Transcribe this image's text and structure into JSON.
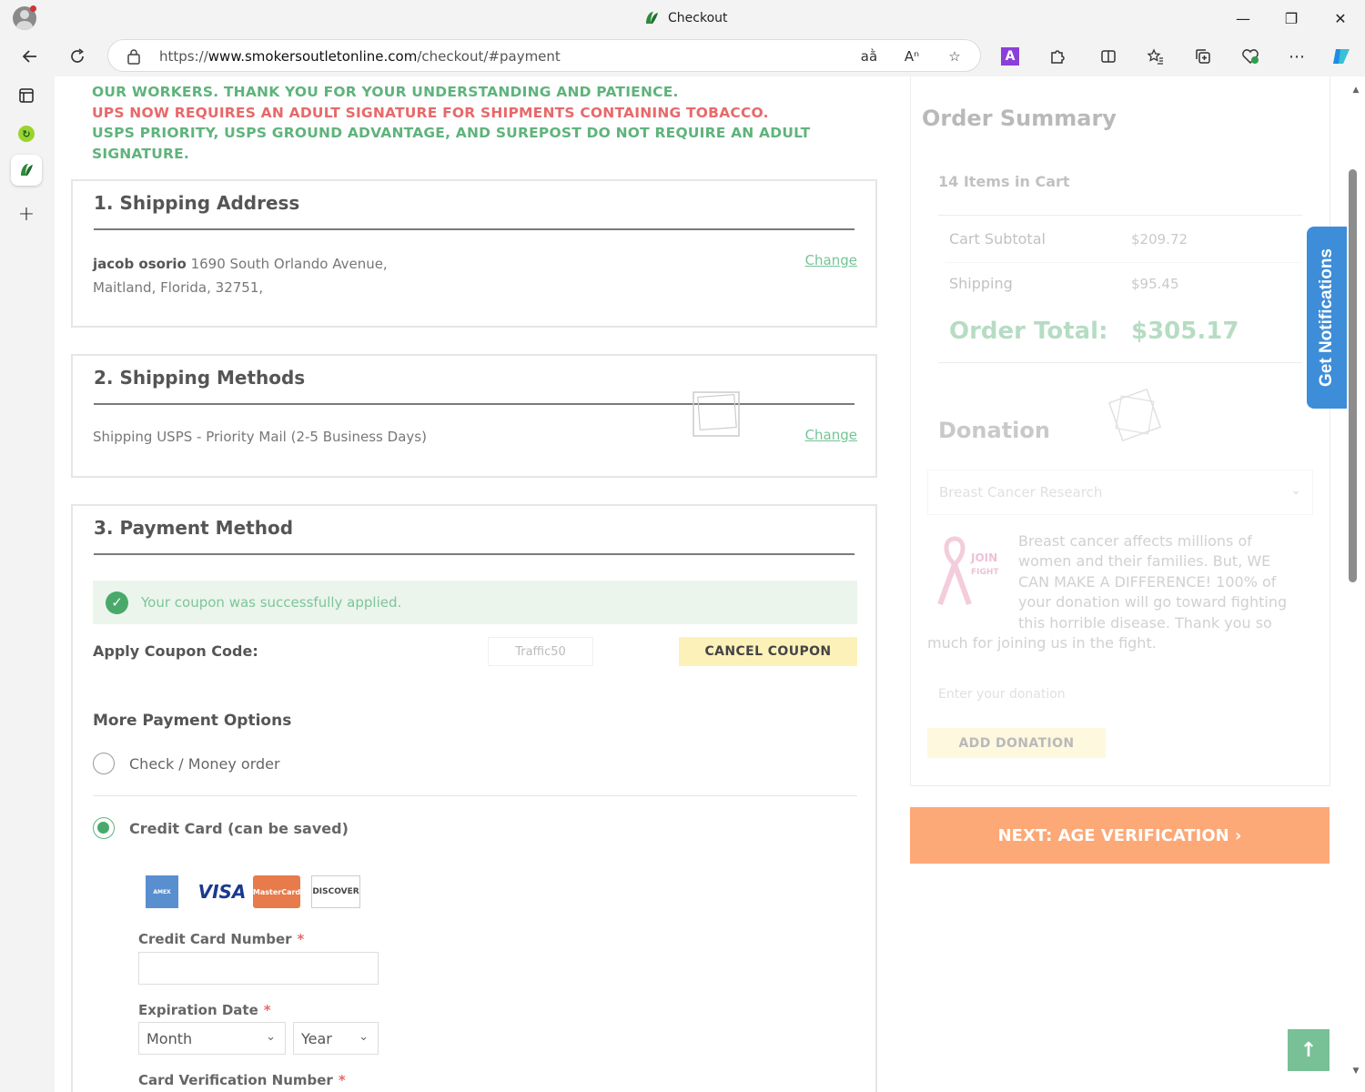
{
  "browser": {
    "window_title": "Checkout",
    "url_prefix": "https://",
    "url_domain": "www.smokersoutletonline.com",
    "url_path": "/checkout/#payment"
  },
  "notice": {
    "line1": "OUR WORKERS. THANK YOU FOR YOUR UNDERSTANDING AND PATIENCE.",
    "line2": "UPS NOW REQUIRES AN ADULT SIGNATURE FOR SHIPMENTS CONTAINING TOBACCO.",
    "line3": "USPS PRIORITY, USPS GROUND ADVANTAGE, AND SUREPOST DO NOT REQUIRE AN ADULT SIGNATURE."
  },
  "shipping_address": {
    "title": "1. Shipping Address",
    "name": "jacob osorio",
    "line1": "1690 South Orlando Avenue,",
    "line2": "Maitland, Florida, 32751,",
    "change_label": "Change"
  },
  "shipping_methods": {
    "title": "2. Shipping Methods",
    "method": "Shipping USPS - Priority Mail (2-5 Business Days)",
    "change_label": "Change"
  },
  "payment": {
    "title": "3. Payment Method",
    "success_message": "Your coupon was successfully applied.",
    "coupon_label": "Apply Coupon Code:",
    "coupon_value": "Traffic50",
    "cancel_coupon_label": "CANCEL COUPON",
    "more_options_label": "More Payment Options",
    "option_check": "Check / Money order",
    "option_card": "Credit Card (can be saved)",
    "cards": [
      "AMEX",
      "VISA",
      "MasterCard",
      "DISCOVER"
    ],
    "cc_number_label": "Credit Card Number",
    "expiration_label": "Expiration Date",
    "month_placeholder": "Month",
    "year_placeholder": "Year",
    "cvv_label": "Card Verification Number",
    "required_mark": "*"
  },
  "summary": {
    "title": "Order Summary",
    "items_count": "14 Items in Cart",
    "subtotal_label": "Cart Subtotal",
    "subtotal_value": "$209.72",
    "shipping_label": "Shipping",
    "shipping_value": "$95.45",
    "total_label": "Order Total:",
    "total_value": "$305.17"
  },
  "donation": {
    "title": "Donation",
    "selected_cause": "Breast Cancer Research",
    "ribbon_text_1": "JOIN",
    "ribbon_text_2": "FIGHT",
    "description": "Breast cancer affects millions of women and their families. But, WE CAN MAKE A DIFFERENCE! 100% of your donation will go toward fighting this horrible disease. Thank you so much for joining us in the fight.",
    "input_placeholder": "Enter your donation",
    "button_label": "ADD DONATION"
  },
  "next_button_label": "NEXT: AGE VERIFICATION ›",
  "notifications_label": "Get Notifications",
  "colors": {
    "green_text": "#5fb37c",
    "red_text": "#e8696a",
    "next_button": "#fda877",
    "coupon_button": "#fdf1ba",
    "notification_tab": "#3e8dd8"
  }
}
